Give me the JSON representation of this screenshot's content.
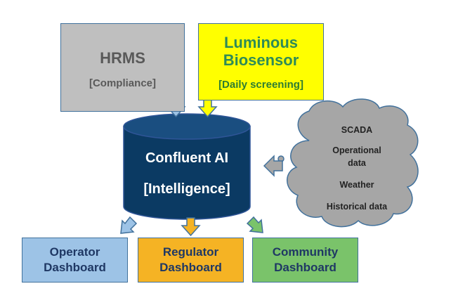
{
  "hrms": {
    "title": "HRMS",
    "subtitle": "[Compliance]"
  },
  "biosensor": {
    "title_line1": "Luminous",
    "title_line2": "Biosensor",
    "subtitle": "[Daily screening]"
  },
  "core": {
    "title": "Confluent AI",
    "subtitle": "[Intelligence]"
  },
  "cloud": {
    "items": [
      {
        "label": "SCADA"
      },
      {
        "label": "Operational\ndata"
      },
      {
        "label": "Weather"
      },
      {
        "label": "Historical data"
      }
    ]
  },
  "dashboards": [
    {
      "line1": "Operator",
      "line2": "Dashboard"
    },
    {
      "line1": "Regulator",
      "line2": "Dashboard"
    },
    {
      "line1": "Community",
      "line2": "Dashboard"
    }
  ],
  "colors": {
    "hrms_fill": "#BFBFBF",
    "biosensor_fill": "#FFFF00",
    "core_fill": "#0B3A63",
    "cloud_fill": "#A6A6A6",
    "operator_fill": "#9DC3E6",
    "regulator_fill": "#F5B324",
    "community_fill": "#7AC36A",
    "arrow_outline": "#41719C"
  }
}
